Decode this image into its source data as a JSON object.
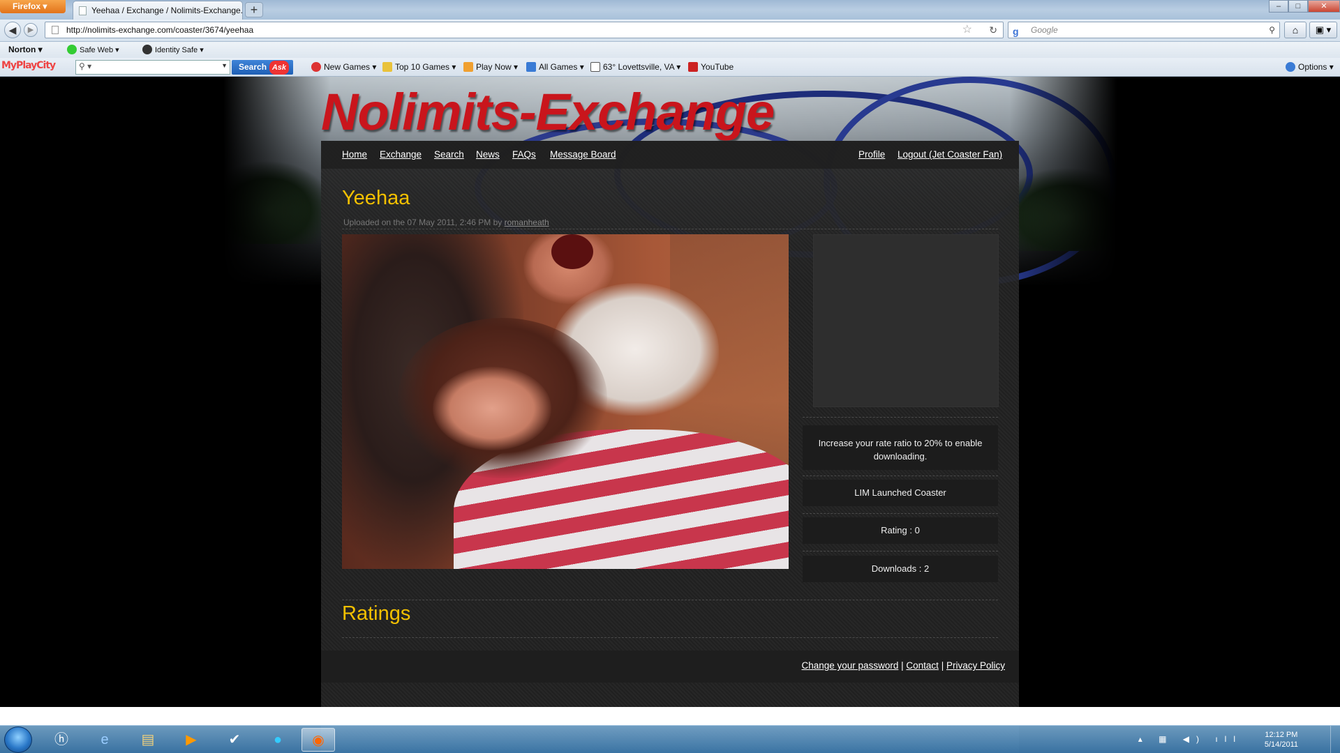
{
  "browser": {
    "menu_button": "Firefox",
    "tab_title": "Yeehaa / Exchange / Nolimits-Exchange....",
    "new_tab": "+",
    "url": "http://nolimits-exchange.com/coaster/3674/yeehaa",
    "search_placeholder": "Google"
  },
  "norton_bar": {
    "brand": "Norton",
    "safe_web": "Safe Web",
    "identity_safe": "Identity Safe"
  },
  "toolbar": {
    "logo": "MyPlayCity",
    "search_button": "Search",
    "search_brand": "Ask",
    "items": [
      "New Games",
      "Top 10 Games",
      "Play Now",
      "All Games",
      "63° Lovettsville, VA",
      "YouTube"
    ],
    "options": "Options"
  },
  "site": {
    "title": "Nolimits-Exchange",
    "nav_left": [
      "Home",
      "Exchange",
      "Search",
      "News",
      "FAQs",
      "Message Board"
    ],
    "nav_right": [
      "Profile",
      "Logout (Jet Coaster Fan)"
    ]
  },
  "coaster": {
    "name": "Yeehaa",
    "uploaded_prefix": "Uploaded on the 07 May 2011, 2:46 PM by",
    "uploader": "romanheath",
    "download_notice": "Increase your rate ratio to 20% to enable downloading.",
    "type": "LIM Launched Coaster",
    "rating": "Rating : 0",
    "downloads": "Downloads : 2"
  },
  "ratings_heading": "Ratings",
  "footer": {
    "change_password": "Change your password",
    "contact": "Contact",
    "privacy": "Privacy Policy",
    "separator": "|"
  },
  "taskbar": {
    "time": "12:12 PM",
    "date": "5/14/2011"
  }
}
